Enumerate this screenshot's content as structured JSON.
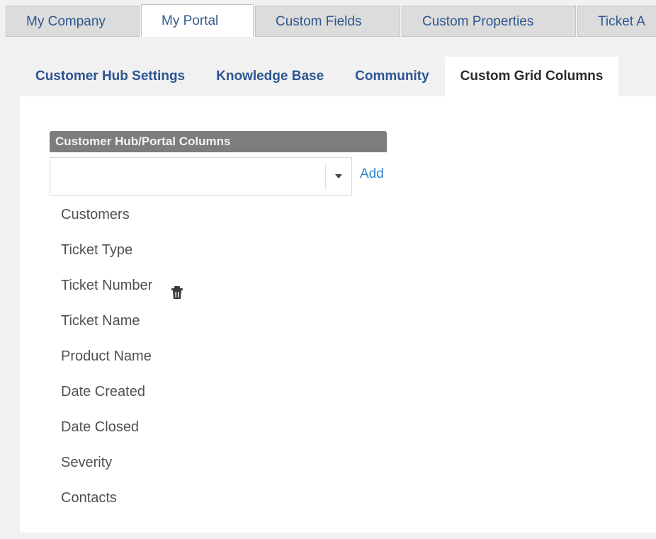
{
  "top_tabs": [
    {
      "label": "My Company"
    },
    {
      "label": "My Portal"
    },
    {
      "label": "Custom Fields"
    },
    {
      "label": "Custom Properties"
    },
    {
      "label": "Ticket A"
    }
  ],
  "active_top_tab": "My Portal",
  "sub_tabs": [
    {
      "label": "Customer Hub Settings"
    },
    {
      "label": "Knowledge Base"
    },
    {
      "label": "Community"
    },
    {
      "label": "Custom Grid Columns"
    }
  ],
  "active_sub_tab": "Custom Grid Columns",
  "section": {
    "title": "Customer Hub/Portal Columns",
    "input_value": "",
    "add_label": "Add"
  },
  "columns": [
    {
      "label": "Customers"
    },
    {
      "label": "Ticket Type"
    },
    {
      "label": "Ticket Number"
    },
    {
      "label": "Ticket Name"
    },
    {
      "label": "Product Name"
    },
    {
      "label": "Date Created"
    },
    {
      "label": "Date Closed"
    },
    {
      "label": "Severity"
    },
    {
      "label": "Contacts"
    }
  ],
  "hovered_column": "Ticket Number",
  "icons": {
    "dropdown": "caret-down-icon",
    "delete": "trash-icon"
  },
  "colors": {
    "link": "#2e84d0",
    "tab_text": "#2e578f",
    "section_header_bg": "#7d7d7d"
  }
}
